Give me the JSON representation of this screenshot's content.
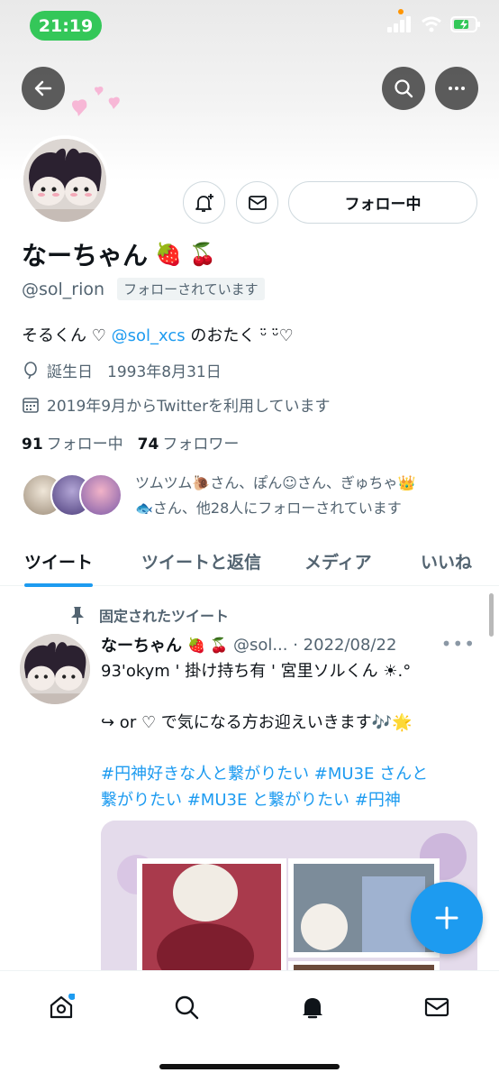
{
  "status_bar": {
    "time": "21:19"
  },
  "profile": {
    "name": "なーちゃん",
    "name_emoji": "🍓 🍒",
    "handle": "@sol_rion",
    "follows_you": "フォローされています",
    "follow_button": "フォロー中",
    "bio_prefix": "そるくん ♡ ",
    "bio_mention": "@sol_xcs",
    "bio_suffix": " のおたく ᵕ̈  ᵕ̈♡",
    "birthday_label": "誕生日",
    "birthday_value": "1993年8月31日",
    "joined": "2019年9月からTwitterを利用しています",
    "following_count": "91",
    "following_label": "フォロー中",
    "followers_count": "74",
    "followers_label": "フォロワー",
    "followed_by_line1": "ツムツム🐌さん、ぽん☺さん、ぎゅちゃ👑",
    "followed_by_line2": "🐟さん、他28人にフォローされています"
  },
  "tabs": [
    {
      "label": "ツイート"
    },
    {
      "label": "ツイートと返信"
    },
    {
      "label": "メディア"
    },
    {
      "label": "いいね"
    }
  ],
  "pinned_tweet": {
    "pinned_label": "固定されたツイート",
    "author": "なーちゃん",
    "author_emoji": "🍓 🍒",
    "handle_date": "@sol... · 2022/08/22",
    "line1": "93'okym ' 掛け持ち有 ' 宮里ソルくん ☀︎.°",
    "line2": "↪ or ♡ で気になる方お迎えいきます🎶🌟",
    "hashtags_line1": "#円神好きな人と繋がりたい #MU3E さんと",
    "hashtags_line2": "繋がりたい #MU3E と繋がりたい #円神"
  },
  "colors": {
    "accent": "#1d9bf0",
    "status_green": "#34c759"
  }
}
